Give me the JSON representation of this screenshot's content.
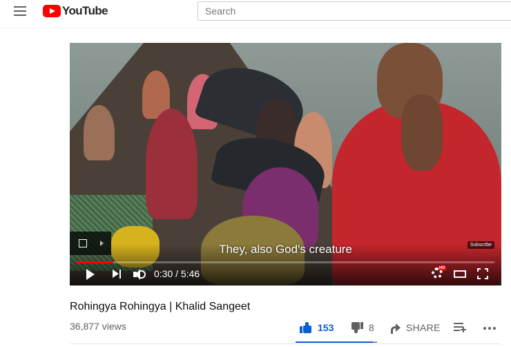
{
  "header": {
    "logo_text": "YouTube",
    "search_placeholder": "Search"
  },
  "player": {
    "subtitle": "They, also God's creature",
    "subscribe_label": "Subscribe",
    "time_display": "0:30 / 5:46",
    "progress_fraction": 0.087,
    "hd_badge": "HD",
    "progress_color": "#ff0000"
  },
  "video": {
    "title": "Rohingya Rohingya | Khalid Sangeet",
    "views": "36,877 views",
    "likes": "153",
    "dislikes": "8",
    "share_label": "SHARE",
    "like_ratio": 0.95,
    "accent_color": "#065fd4"
  },
  "icons": [
    "hamburger-menu-icon",
    "youtube-logo-icon",
    "miniplayer-icon",
    "play-icon",
    "next-icon",
    "volume-icon",
    "settings-gear-icon",
    "theater-mode-icon",
    "fullscreen-icon",
    "thumbs-up-icon",
    "thumbs-down-icon",
    "share-icon",
    "add-to-playlist-icon",
    "more-actions-icon"
  ]
}
